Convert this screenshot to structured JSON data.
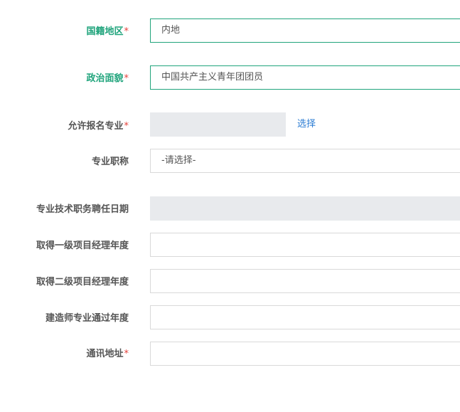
{
  "form": {
    "nationality": {
      "label": "国籍地区",
      "required_mark": "*",
      "value": "内地"
    },
    "political_status": {
      "label": "政治面貌",
      "required_mark": "*",
      "value": "中国共产主义青年团团员"
    },
    "allowed_major": {
      "label": "允许报名专业",
      "required_mark": "*",
      "value": "",
      "select_link": "选择"
    },
    "professional_title": {
      "label": "专业职称",
      "value": "-请选择-"
    },
    "tech_appointment_date": {
      "label": "专业技术职务聘任日期",
      "value": ""
    },
    "first_class_pm_year": {
      "label": "取得一级项目经理年度",
      "value": ""
    },
    "second_class_pm_year": {
      "label": "取得二级项目经理年度",
      "value": ""
    },
    "constructor_pass_year": {
      "label": "建造师专业通过年度",
      "value": ""
    },
    "mailing_address": {
      "label": "通讯地址",
      "required_mark": "*",
      "value": ""
    }
  }
}
